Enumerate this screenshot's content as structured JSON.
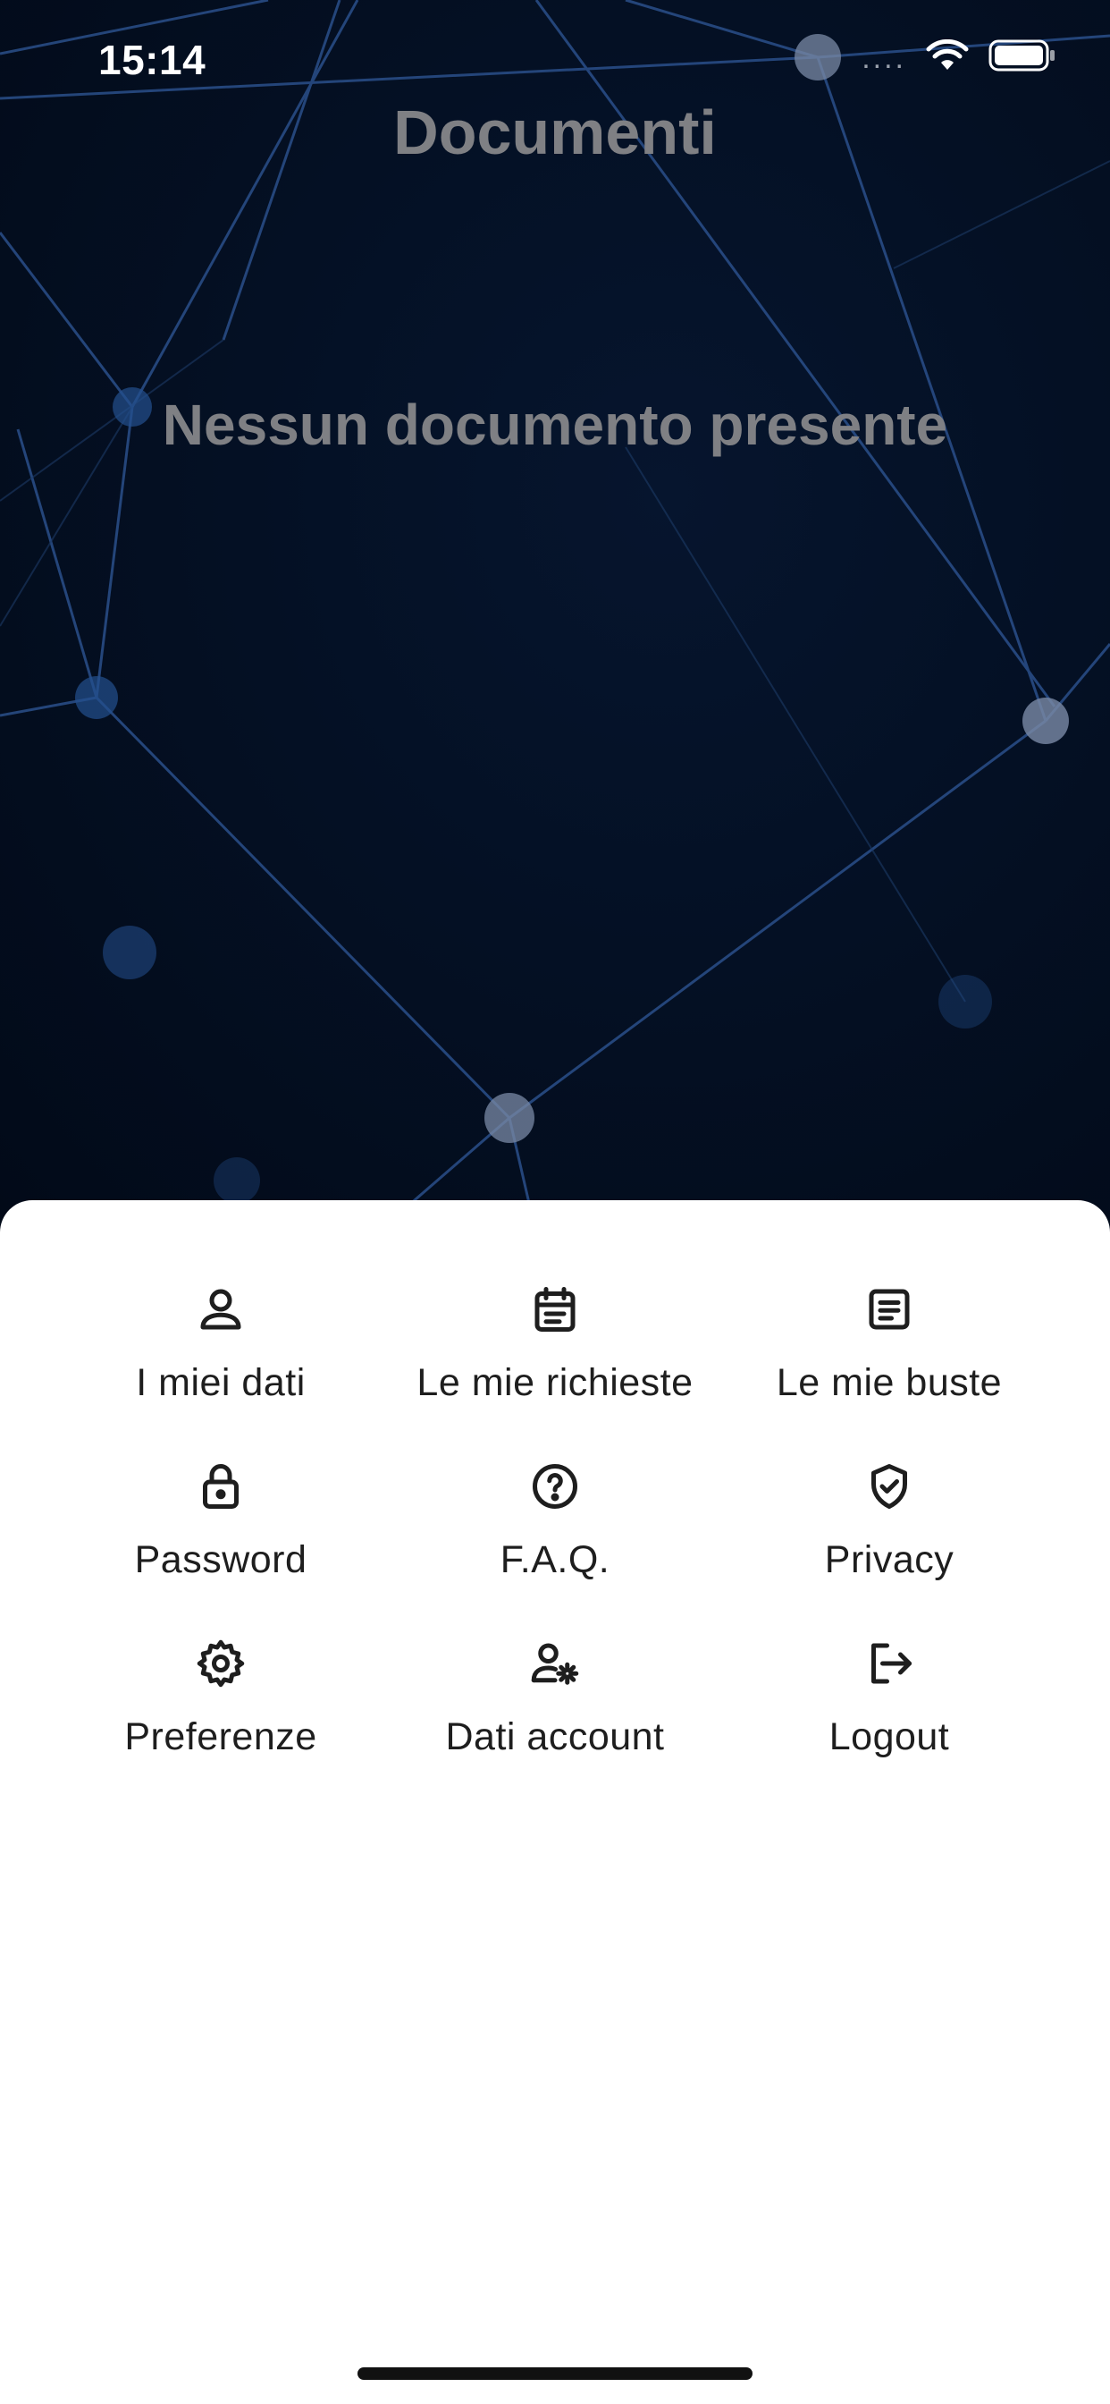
{
  "status_bar": {
    "time": "15:14",
    "signal_icon": "signal-dots-icon",
    "wifi_icon": "wifi-icon",
    "battery_icon": "battery-icon"
  },
  "header": {
    "title": "Documenti"
  },
  "main": {
    "empty_message": "Nessun documento presente"
  },
  "menu": {
    "items": [
      {
        "label": "I miei dati",
        "icon": "person-icon"
      },
      {
        "label": "Le mie richieste",
        "icon": "calendar-icon"
      },
      {
        "label": "Le mie buste",
        "icon": "document-icon"
      },
      {
        "label": "Password",
        "icon": "lock-icon"
      },
      {
        "label": "F.A.Q.",
        "icon": "help-circle-icon"
      },
      {
        "label": "Privacy",
        "icon": "shield-check-icon"
      },
      {
        "label": "Preferenze",
        "icon": "gear-icon"
      },
      {
        "label": "Dati account",
        "icon": "user-settings-icon"
      },
      {
        "label": "Logout",
        "icon": "logout-icon"
      }
    ]
  },
  "colors": {
    "background_dark": "#041024",
    "network_lines": "#2a4f8a",
    "title_gray": "#7f8084",
    "sheet_white": "#ffffff",
    "icon_dark": "#1e1e1e"
  }
}
